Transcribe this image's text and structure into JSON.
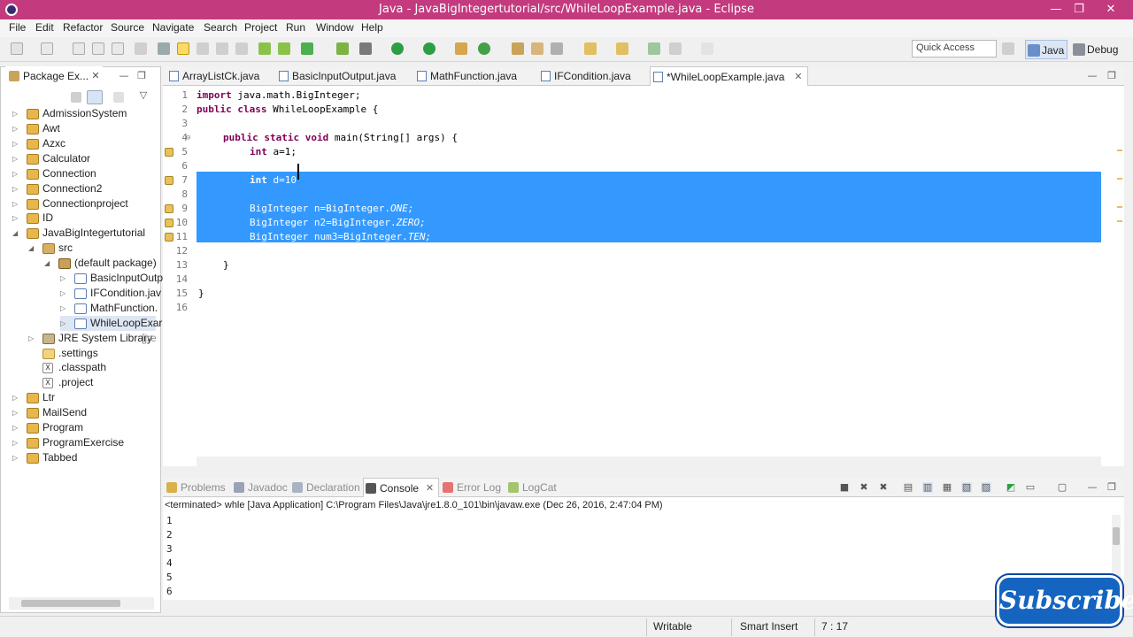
{
  "window": {
    "title": "Java - JavaBigIntegertutorial/src/WhileLoopExample.java - Eclipse"
  },
  "menu": [
    "File",
    "Edit",
    "Refactor",
    "Source",
    "Navigate",
    "Search",
    "Project",
    "Run",
    "Window",
    "Help"
  ],
  "toolbar": {
    "quick_access": "Quick Access",
    "perspective_java": "Java",
    "perspective_debug": "Debug"
  },
  "package_explorer": {
    "title": "Package Ex...",
    "items": [
      {
        "label": "AdmissionSystem"
      },
      {
        "label": "Awt"
      },
      {
        "label": "Azxc"
      },
      {
        "label": "Calculator"
      },
      {
        "label": "Connection"
      },
      {
        "label": "Connection2"
      },
      {
        "label": "Connectionproject"
      },
      {
        "label": "ID"
      },
      {
        "label": "JavaBigIntegertutorial"
      },
      {
        "label": "src"
      },
      {
        "label": "(default package)"
      },
      {
        "label": "BasicInputOutp"
      },
      {
        "label": "IFCondition.jav"
      },
      {
        "label": "MathFunction."
      },
      {
        "label": "WhileLoopExar"
      },
      {
        "label": "JRE System Library",
        "suffix": "[jre"
      },
      {
        "label": ".settings"
      },
      {
        "label": ".classpath"
      },
      {
        "label": ".project"
      },
      {
        "label": "Ltr"
      },
      {
        "label": "MailSend"
      },
      {
        "label": "Program"
      },
      {
        "label": "ProgramExercise"
      },
      {
        "label": "Tabbed"
      }
    ]
  },
  "editor_tabs": [
    {
      "label": "ArrayListCk.java"
    },
    {
      "label": "BasicInputOutput.java"
    },
    {
      "label": "MathFunction.java"
    },
    {
      "label": "IFCondition.java"
    },
    {
      "label": "*WhileLoopExample.java"
    }
  ],
  "code": {
    "line_numbers": [
      "1",
      "2",
      "3",
      "4",
      "5",
      "6",
      "7",
      "8",
      "9",
      "10",
      "11",
      "12",
      "13",
      "14",
      "15",
      "16"
    ],
    "l1_kw": "import",
    "l1_rest": " java.math.BigInteger;",
    "l2_kw1": "public",
    "l2_kw2": "class",
    "l2_rest": " WhileLoopExample {",
    "l4_kw1": "public",
    "l4_kw2": "static",
    "l4_kw3": "void",
    "l4_rest": " main(String[] args) {",
    "l5_kw": "int",
    "l5_rest": " a=1;",
    "l7_kw": "int",
    "l7_rest": " d=10",
    "l9_a": "BigInteger n=BigInteger.",
    "l9_b": "ONE;",
    "l10_a": "BigInteger n2=BigInteger.",
    "l10_b": "ZERO;",
    "l11_a": "BigInteger num3=BigInteger.",
    "l11_b": "TEN;",
    "l13": "}",
    "l15": "}"
  },
  "bottom_tabs": [
    {
      "label": "Problems"
    },
    {
      "label": "Javadoc"
    },
    {
      "label": "Declaration"
    },
    {
      "label": "Console"
    },
    {
      "label": "Error Log"
    },
    {
      "label": "LogCat"
    }
  ],
  "console": {
    "header": "<terminated> whle [Java Application] C:\\Program Files\\Java\\jre1.8.0_101\\bin\\javaw.exe (Dec 26, 2016, 2:47:04 PM)",
    "lines": [
      "1",
      "2",
      "3",
      "4",
      "5",
      "6"
    ]
  },
  "status": {
    "writable": "Writable",
    "insert_mode": "Smart Insert",
    "position": "7 : 17"
  },
  "overlay": {
    "subscribe": "Subscribe"
  },
  "colors": {
    "titlebar": "#c43a7f",
    "selection": "#3399ff",
    "keyword": "#7f0055"
  }
}
